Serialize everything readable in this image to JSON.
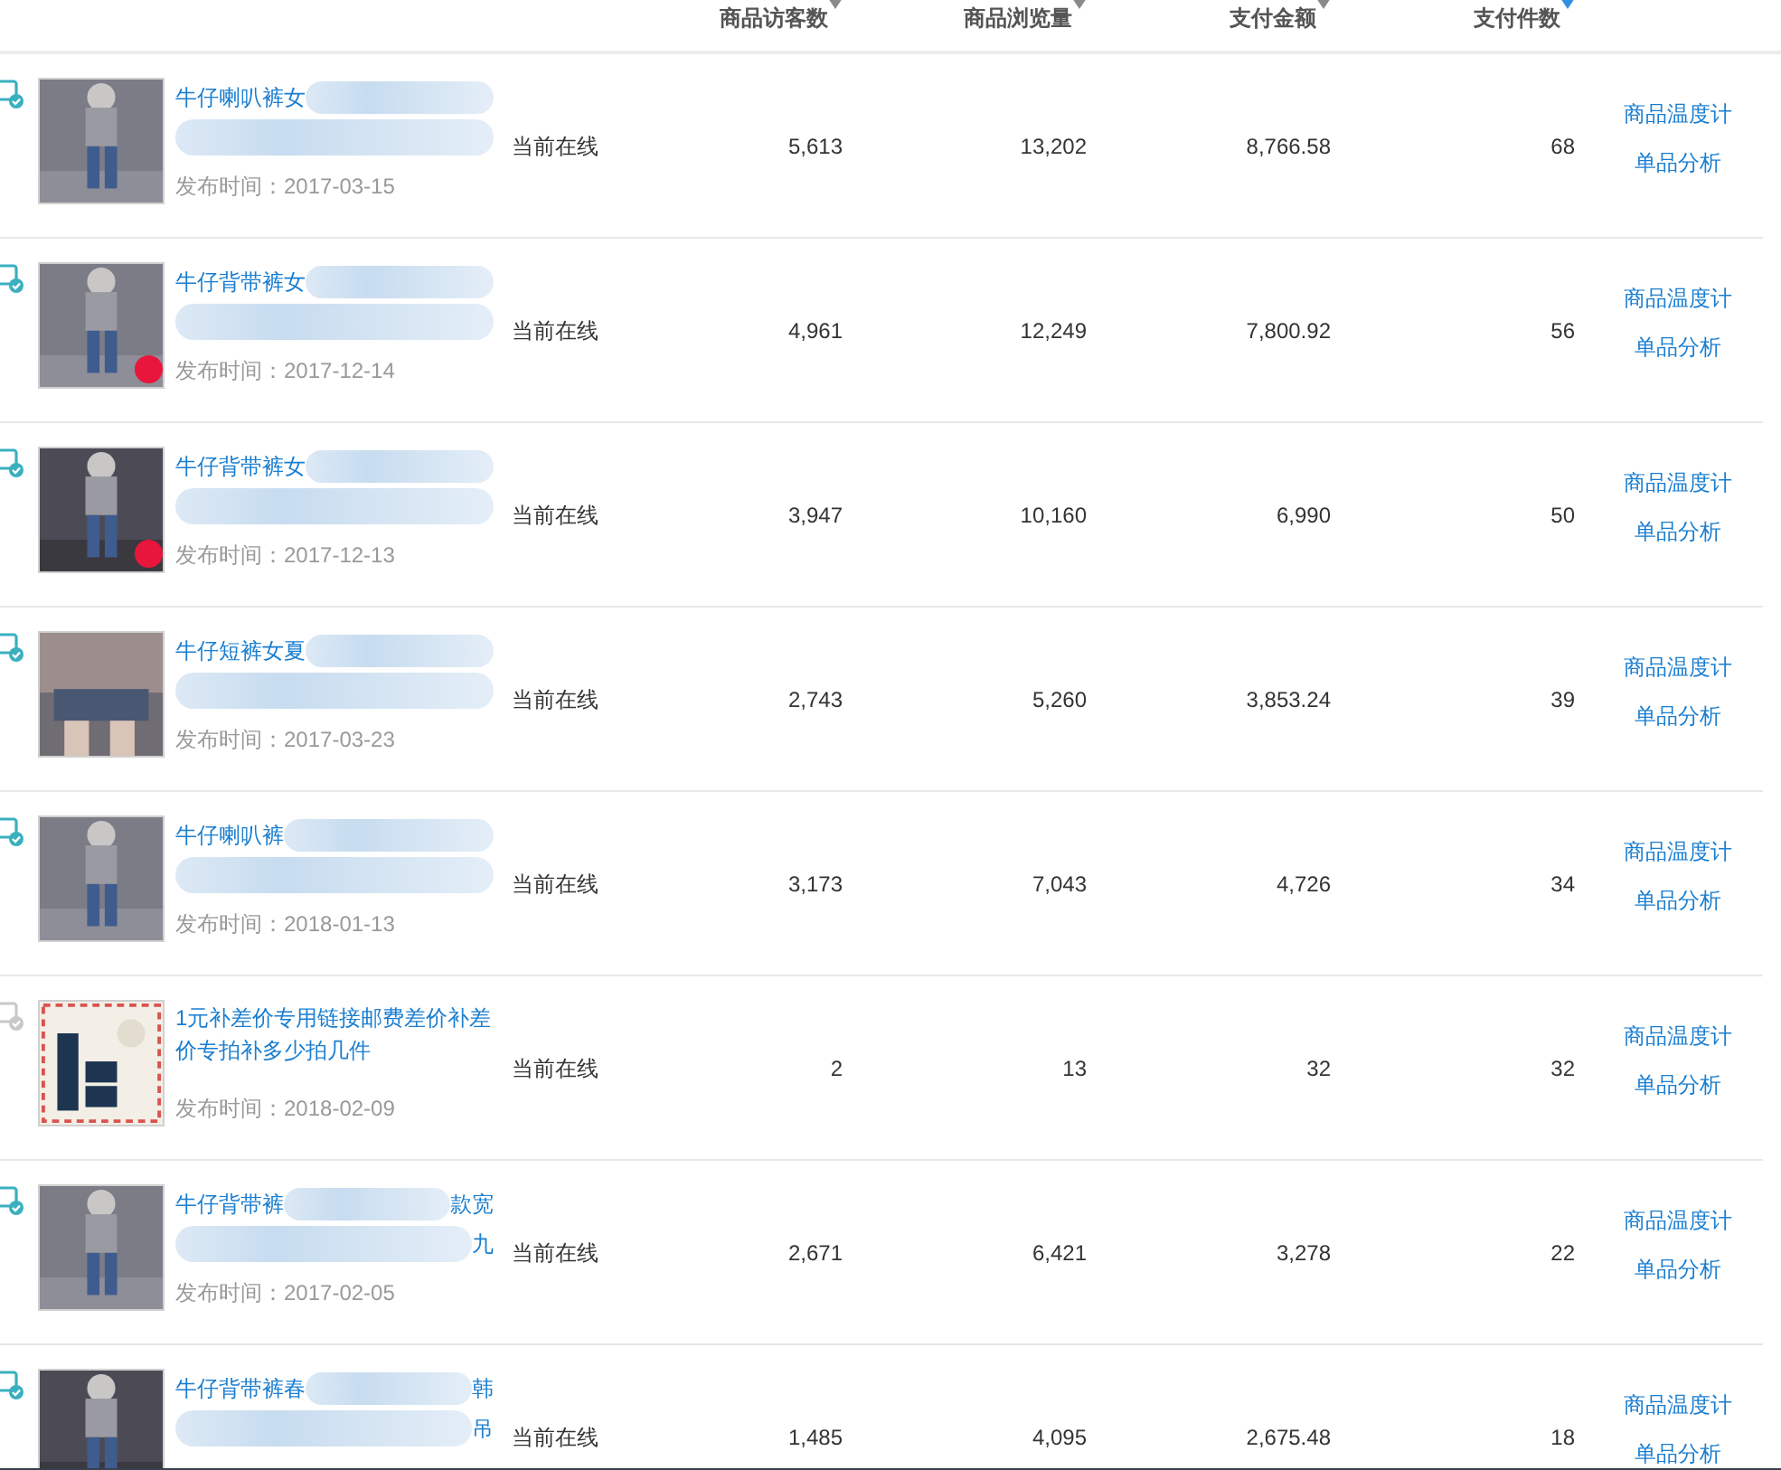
{
  "table": {
    "columns": [
      {
        "label": "商品访客数",
        "selected": false
      },
      {
        "label": "商品浏览量",
        "selected": false
      },
      {
        "label": "支付金额",
        "selected": false
      },
      {
        "label": "支付件数",
        "selected": true
      }
    ],
    "rows": [
      {
        "online": true,
        "kind": "redacted",
        "title": "牛仔喇叭裤女",
        "date": "发布时间：2017-03-15",
        "status": "当前在线",
        "visitors": "5,613",
        "views": "13,202",
        "amount": "8,766.58",
        "count": "68",
        "actions": [
          "商品温度计",
          "单品分析"
        ]
      },
      {
        "online": true,
        "kind": "redacted",
        "title": "牛仔背带裤女",
        "date": "发布时间：2017-12-14",
        "status": "当前在线",
        "visitors": "4,961",
        "views": "12,249",
        "amount": "7,800.92",
        "count": "56",
        "actions": [
          "商品温度计",
          "单品分析"
        ]
      },
      {
        "online": true,
        "kind": "redacted",
        "title": "牛仔背带裤女",
        "date": "发布时间：2017-12-13",
        "status": "当前在线",
        "visitors": "3,947",
        "views": "10,160",
        "amount": "6,990",
        "count": "50",
        "actions": [
          "商品温度计",
          "单品分析"
        ]
      },
      {
        "online": true,
        "kind": "redacted",
        "title": "牛仔短裤女夏",
        "date": "发布时间：2017-03-23",
        "status": "当前在线",
        "visitors": "2,743",
        "views": "5,260",
        "amount": "3,853.24",
        "count": "39",
        "actions": [
          "商品温度计",
          "单品分析"
        ]
      },
      {
        "online": true,
        "kind": "redacted",
        "title": "牛仔喇叭裤",
        "date": "发布时间：2018-01-13",
        "status": "当前在线",
        "visitors": "3,173",
        "views": "7,043",
        "amount": "4,726",
        "count": "34",
        "actions": [
          "商品温度计",
          "单品分析"
        ]
      },
      {
        "online": false,
        "kind": "plain",
        "title": "1元补差价专用链接邮费差价补差价专拍补多少拍几件",
        "date": "发布时间：2018-02-09",
        "status": "当前在线",
        "visitors": "2",
        "views": "13",
        "amount": "32",
        "count": "32",
        "actions": [
          "商品温度计",
          "单品分析"
        ]
      },
      {
        "online": true,
        "kind": "redacted",
        "title": "牛仔背带裤",
        "line1_end": "款宽",
        "line2_end": "九",
        "date": "发布时间：2017-02-05",
        "status": "当前在线",
        "visitors": "2,671",
        "views": "6,421",
        "amount": "3,278",
        "count": "22",
        "actions": [
          "商品温度计",
          "单品分析"
        ]
      },
      {
        "online": true,
        "kind": "redacted",
        "title": "牛仔背带裤春",
        "line1_end": "韩",
        "line2_end": "吊",
        "status": "当前在线",
        "visitors": "1,485",
        "views": "4,095",
        "amount": "2,675.48",
        "count": "18",
        "actions": [
          "商品温度计",
          "单品分析"
        ]
      }
    ]
  }
}
